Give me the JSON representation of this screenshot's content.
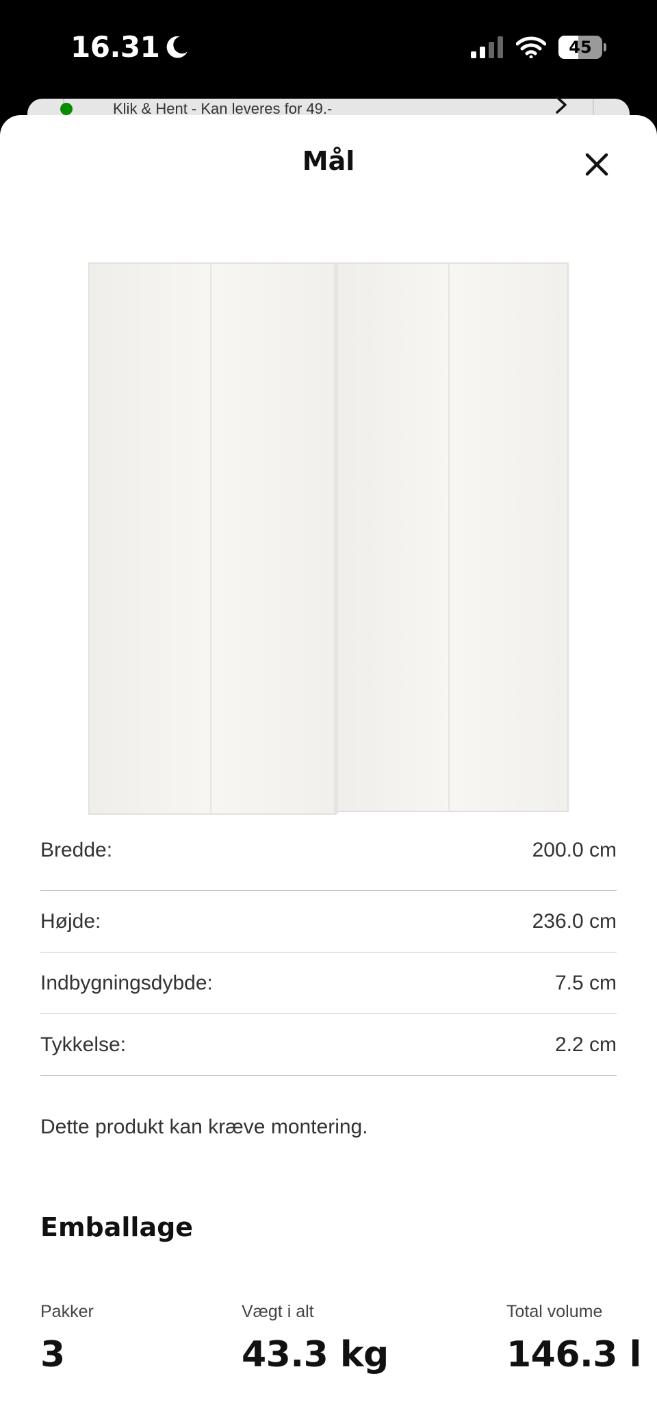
{
  "status_bar": {
    "time": "16.31",
    "battery_level": "45"
  },
  "underlay": {
    "text": "Klik & Hent - Kan leveres for 49.-",
    "status_color": "#0a8a00"
  },
  "sheet": {
    "title": "Mål",
    "dimensions": [
      {
        "label": "Bredde:",
        "value": "200.0 cm"
      },
      {
        "label": "Højde:",
        "value": "236.0 cm"
      },
      {
        "label": "Indbygningsdybde:",
        "value": "7.5 cm"
      },
      {
        "label": "Tykkelse:",
        "value": "2.2 cm"
      }
    ],
    "assembly_note": "Dette produkt kan kræve montering.",
    "packaging": {
      "title": "Emballage",
      "packages_label": "Pakker",
      "packages_value": "3",
      "weight_label": "Vægt i alt",
      "weight_value": "43.3 kg",
      "volume_label": "Total volume",
      "volume_value": "146.3 l"
    }
  },
  "icons": [
    "moon-icon",
    "cellular-signal-icon",
    "wifi-icon",
    "battery-icon",
    "chevron-right-icon",
    "close-icon"
  ]
}
